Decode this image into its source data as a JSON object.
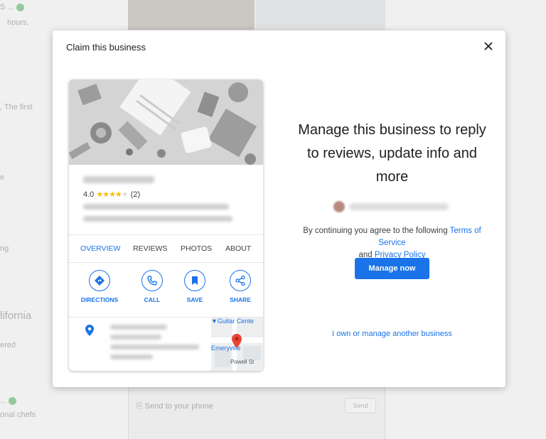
{
  "background": {
    "left_texts": [
      "S ...",
      "hours,",
      ", The first",
      "e",
      "ng",
      "lifornia",
      "ered",
      "...",
      "onal chefs"
    ],
    "send_to_phone": "Send to your phone",
    "send_button": "Send"
  },
  "dialog": {
    "title": "Claim this business",
    "close_icon": "close-icon"
  },
  "card": {
    "rating_value": "4.0",
    "rating_stars": "★★★★",
    "rating_empty_star": "★",
    "rating_count": "(2)",
    "tabs": [
      {
        "label": "OVERVIEW",
        "active": true
      },
      {
        "label": "REVIEWS",
        "active": false
      },
      {
        "label": "PHOTOS",
        "active": false
      },
      {
        "label": "ABOUT",
        "active": false
      }
    ],
    "actions": [
      {
        "label": "DIRECTIONS",
        "icon": "directions-icon"
      },
      {
        "label": "CALL",
        "icon": "phone-icon"
      },
      {
        "label": "SAVE",
        "icon": "bookmark-icon"
      },
      {
        "label": "SHARE",
        "icon": "share-icon"
      }
    ],
    "map_labels": {
      "guitar_center": "Guitar Cente",
      "emeryville": "Emeryville",
      "street": "Powell St"
    }
  },
  "right": {
    "headline": "Manage this business to reply to reviews, update info and more",
    "terms_prefix": "By continuing you agree to the following",
    "terms_link": "Terms of Service",
    "terms_and": "and",
    "privacy_link": "Privacy Policy",
    "manage_button": "Manage now",
    "own_link": "I own or manage another business"
  },
  "colors": {
    "accent": "#1a73e8",
    "star": "#fbbc04"
  }
}
